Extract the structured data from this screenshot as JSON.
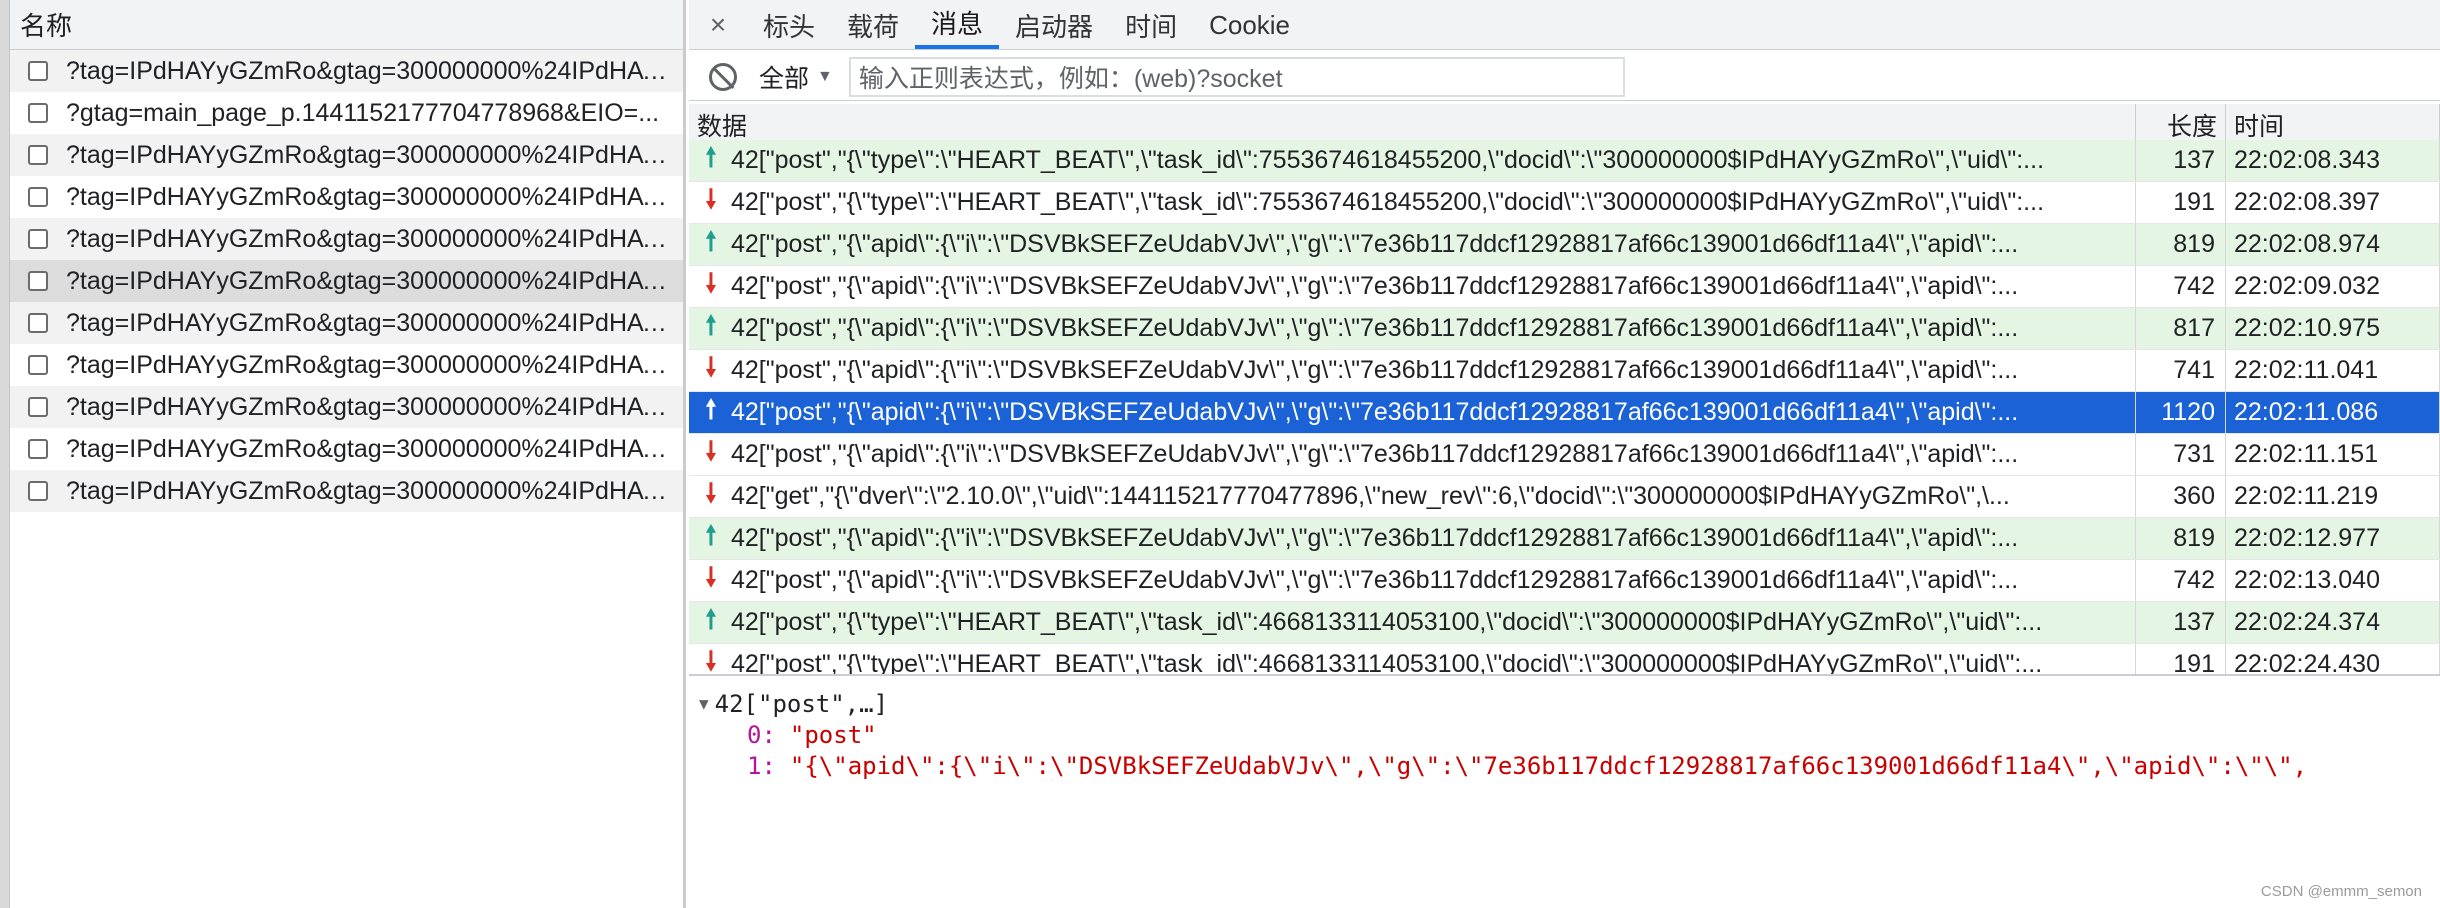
{
  "left": {
    "header": "名称",
    "requests": [
      "?tag=IPdHAYyGZmRo&gtag=300000000%24IPdHAYyGZmRo...",
      "?gtag=main_page_p.1441152177704778968&EIO=...",
      "?tag=IPdHAYyGZmRo&gtag=300000000%24IPdHAYyGZmRo...",
      "?tag=IPdHAYyGZmRo&gtag=300000000%24IPdHAYyGZmRo...",
      "?tag=IPdHAYyGZmRo&gtag=300000000%24IPdHAYyGZmRo...",
      "?tag=IPdHAYyGZmRo&gtag=300000000%24IPdHAYyGZmRo...",
      "?tag=IPdHAYyGZmRo&gtag=300000000%24IPdHAYyGZmRo...",
      "?tag=IPdHAYyGZmRo&gtag=300000000%24IPdHAYyGZmRo...",
      "?tag=IPdHAYyGZmRo&gtag=300000000%24IPdHAYyGZmRo...",
      "?tag=IPdHAYyGZmRo&gtag=300000000%24IPdHAYyGZmRo...",
      "?tag=IPdHAYyGZmRo&gtag=300000000%24IPdHAYyGZmRo..."
    ]
  },
  "tabs": {
    "close": "×",
    "items": [
      "标头",
      "载荷",
      "消息",
      "启动器",
      "时间",
      "Cookie"
    ],
    "active": "消息"
  },
  "filter": {
    "select_label": "全部",
    "select_arrow": "▼",
    "input_placeholder": "输入正则表达式，例如：(web)?socket"
  },
  "table": {
    "headers": {
      "data": "数据",
      "length": "长度",
      "time": "时间"
    },
    "rows": [
      {
        "dir": "up",
        "data": "42[\"post\",\"{\\\"type\\\":\\\"HEART_BEAT\\\",\\\"task_id\\\":7553674618455200,\\\"docid\\\":\\\"300000000$IPdHAYyGZmRo\\\",\\\"uid\\\":...",
        "length": "137",
        "time": "22:02:08.343"
      },
      {
        "dir": "down",
        "data": "42[\"post\",\"{\\\"type\\\":\\\"HEART_BEAT\\\",\\\"task_id\\\":7553674618455200,\\\"docid\\\":\\\"300000000$IPdHAYyGZmRo\\\",\\\"uid\\\":...",
        "length": "191",
        "time": "22:02:08.397"
      },
      {
        "dir": "up",
        "data": "42[\"post\",\"{\\\"apid\\\":{\\\"i\\\":\\\"DSVBkSEFZeUdabVJv\\\",\\\"g\\\":\\\"7e36b117ddcf12928817af66c139001d66df11a4\\\",\\\"apid\\\":...",
        "length": "819",
        "time": "22:02:08.974"
      },
      {
        "dir": "down",
        "data": "42[\"post\",\"{\\\"apid\\\":{\\\"i\\\":\\\"DSVBkSEFZeUdabVJv\\\",\\\"g\\\":\\\"7e36b117ddcf12928817af66c139001d66df11a4\\\",\\\"apid\\\":...",
        "length": "742",
        "time": "22:02:09.032"
      },
      {
        "dir": "up",
        "data": "42[\"post\",\"{\\\"apid\\\":{\\\"i\\\":\\\"DSVBkSEFZeUdabVJv\\\",\\\"g\\\":\\\"7e36b117ddcf12928817af66c139001d66df11a4\\\",\\\"apid\\\":...",
        "length": "817",
        "time": "22:02:10.975"
      },
      {
        "dir": "down",
        "data": "42[\"post\",\"{\\\"apid\\\":{\\\"i\\\":\\\"DSVBkSEFZeUdabVJv\\\",\\\"g\\\":\\\"7e36b117ddcf12928817af66c139001d66df11a4\\\",\\\"apid\\\":...",
        "length": "741",
        "time": "22:02:11.041"
      },
      {
        "dir": "up",
        "selected": true,
        "data": "42[\"post\",\"{\\\"apid\\\":{\\\"i\\\":\\\"DSVBkSEFZeUdabVJv\\\",\\\"g\\\":\\\"7e36b117ddcf12928817af66c139001d66df11a4\\\",\\\"apid\\\":...",
        "length": "1120",
        "time": "22:02:11.086"
      },
      {
        "dir": "down",
        "data": "42[\"post\",\"{\\\"apid\\\":{\\\"i\\\":\\\"DSVBkSEFZeUdabVJv\\\",\\\"g\\\":\\\"7e36b117ddcf12928817af66c139001d66df11a4\\\",\\\"apid\\\":...",
        "length": "731",
        "time": "22:02:11.151"
      },
      {
        "dir": "down",
        "data": "42[\"get\",\"{\\\"dver\\\":\\\"2.10.0\\\",\\\"uid\\\":144115217770477896,\\\"new_rev\\\":6,\\\"docid\\\":\\\"300000000$IPdHAYyGZmRo\\\",\\...",
        "length": "360",
        "time": "22:02:11.219"
      },
      {
        "dir": "up",
        "data": "42[\"post\",\"{\\\"apid\\\":{\\\"i\\\":\\\"DSVBkSEFZeUdabVJv\\\",\\\"g\\\":\\\"7e36b117ddcf12928817af66c139001d66df11a4\\\",\\\"apid\\\":...",
        "length": "819",
        "time": "22:02:12.977"
      },
      {
        "dir": "down",
        "data": "42[\"post\",\"{\\\"apid\\\":{\\\"i\\\":\\\"DSVBkSEFZeUdabVJv\\\",\\\"g\\\":\\\"7e36b117ddcf12928817af66c139001d66df11a4\\\",\\\"apid\\\":...",
        "length": "742",
        "time": "22:02:13.040"
      },
      {
        "dir": "up",
        "data": "42[\"post\",\"{\\\"type\\\":\\\"HEART_BEAT\\\",\\\"task_id\\\":4668133114053100,\\\"docid\\\":\\\"300000000$IPdHAYyGZmRo\\\",\\\"uid\\\":...",
        "length": "137",
        "time": "22:02:24.374"
      },
      {
        "dir": "down",
        "data": "42[\"post\",\"{\\\"type\\\":\\\"HEART_BEAT\\\",\\\"task_id\\\":4668133114053100,\\\"docid\\\":\\\"300000000$IPdHAYyGZmRo\\\",\\\"uid\\\":...",
        "length": "191",
        "time": "22:02:24.430"
      }
    ]
  },
  "detail": {
    "summary": "42[\"post\",…]",
    "item0_key": "0:",
    "item0_value": "\"post\"",
    "item1_key": "1:",
    "item1_value": "\"{\\\"apid\\\":{\\\"i\\\":\\\"DSVBkSEFZeUdabVJv\\\",\\\"g\\\":\\\"7e36b117ddcf12928817af66c139001d66df11a4\\\",\\\"apid\\\":\\\"\\\","
  },
  "watermark": "CSDN @emmm_semon",
  "icons": {
    "up_arrow": "🠕",
    "down_arrow": "🠗"
  }
}
